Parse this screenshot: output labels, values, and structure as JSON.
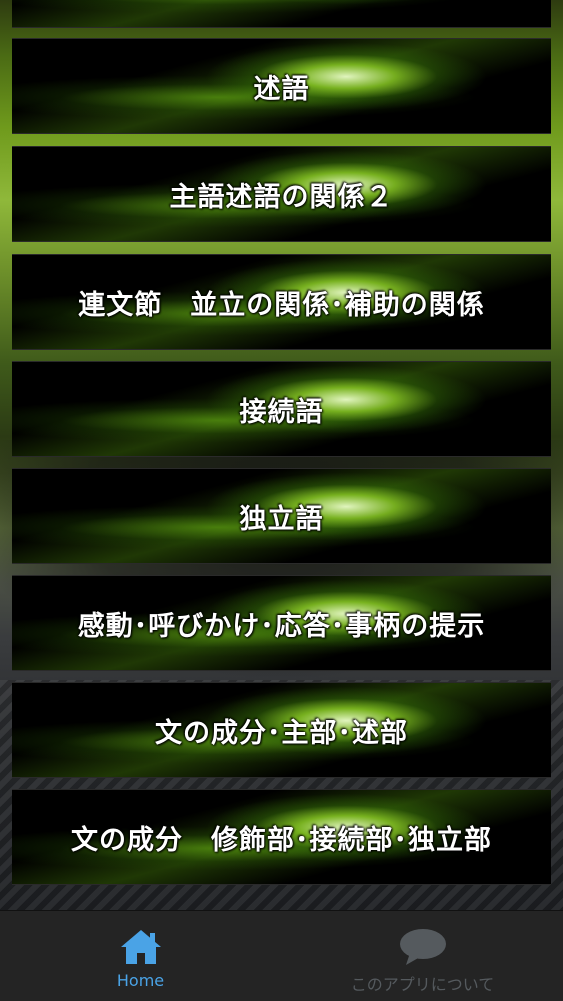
{
  "list": {
    "items": [
      {
        "label": ""
      },
      {
        "label": "述語"
      },
      {
        "label": "主語述語の関係２"
      },
      {
        "label": "連文節　並立の関係･補助の関係"
      },
      {
        "label": "接続語"
      },
      {
        "label": "独立語"
      },
      {
        "label": "感動･呼びかけ･応答･事柄の提示"
      },
      {
        "label": "文の成分･主部･述部"
      },
      {
        "label": "文の成分　修飾部･接続部･独立部"
      }
    ]
  },
  "nav": {
    "home": {
      "label": "Home",
      "icon": "home-icon",
      "color": "#4aa3e6"
    },
    "about": {
      "label": "このアプリについて",
      "icon": "speech-bubble-icon",
      "color": "#555a5e"
    }
  }
}
